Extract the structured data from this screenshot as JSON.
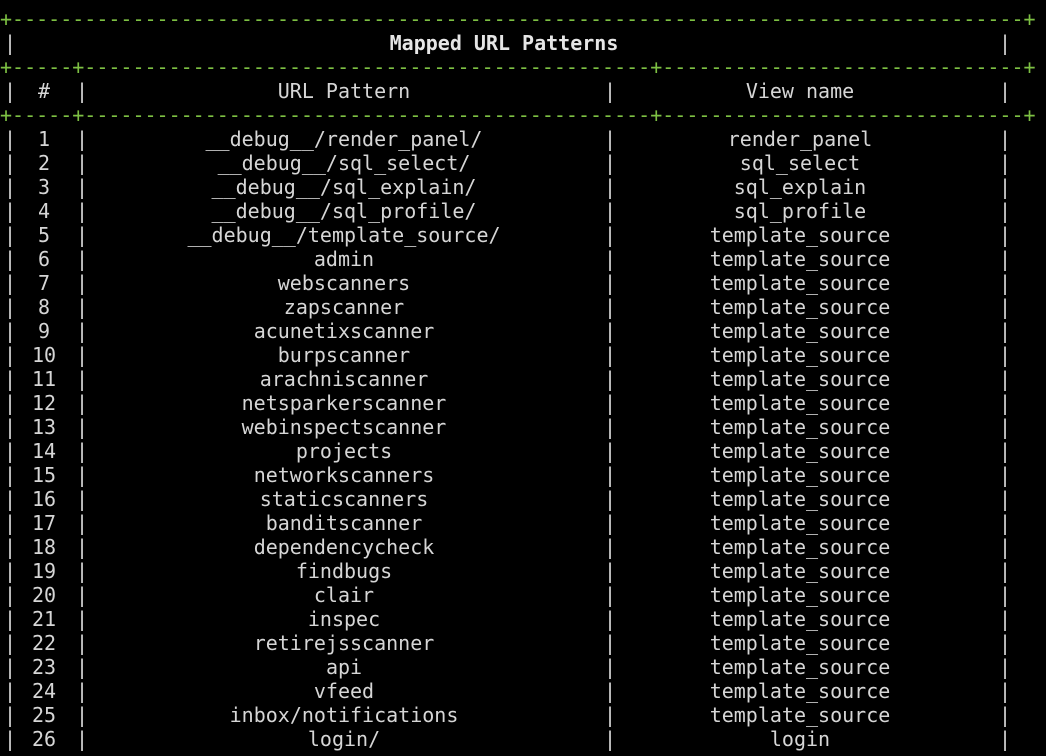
{
  "title": "Mapped URL Patterns",
  "headers": {
    "index": "#",
    "url_pattern": "URL Pattern",
    "view_name": "View name"
  },
  "rows": [
    {
      "num": "1",
      "pattern": "__debug__/render_panel/",
      "view": "render_panel"
    },
    {
      "num": "2",
      "pattern": "__debug__/sql_select/",
      "view": "sql_select"
    },
    {
      "num": "3",
      "pattern": "__debug__/sql_explain/",
      "view": "sql_explain"
    },
    {
      "num": "4",
      "pattern": "__debug__/sql_profile/",
      "view": "sql_profile"
    },
    {
      "num": "5",
      "pattern": "__debug__/template_source/",
      "view": "template_source"
    },
    {
      "num": "6",
      "pattern": "admin",
      "view": "template_source"
    },
    {
      "num": "7",
      "pattern": "webscanners",
      "view": "template_source"
    },
    {
      "num": "8",
      "pattern": "zapscanner",
      "view": "template_source"
    },
    {
      "num": "9",
      "pattern": "acunetixscanner",
      "view": "template_source"
    },
    {
      "num": "10",
      "pattern": "burpscanner",
      "view": "template_source"
    },
    {
      "num": "11",
      "pattern": "arachniscanner",
      "view": "template_source"
    },
    {
      "num": "12",
      "pattern": "netsparkerscanner",
      "view": "template_source"
    },
    {
      "num": "13",
      "pattern": "webinspectscanner",
      "view": "template_source"
    },
    {
      "num": "14",
      "pattern": "projects",
      "view": "template_source"
    },
    {
      "num": "15",
      "pattern": "networkscanners",
      "view": "template_source"
    },
    {
      "num": "16",
      "pattern": "staticscanners",
      "view": "template_source"
    },
    {
      "num": "17",
      "pattern": "banditscanner",
      "view": "template_source"
    },
    {
      "num": "18",
      "pattern": "dependencycheck",
      "view": "template_source"
    },
    {
      "num": "19",
      "pattern": "findbugs",
      "view": "template_source"
    },
    {
      "num": "20",
      "pattern": "clair",
      "view": "template_source"
    },
    {
      "num": "21",
      "pattern": "inspec",
      "view": "template_source"
    },
    {
      "num": "22",
      "pattern": "retirejsscanner",
      "view": "template_source"
    },
    {
      "num": "23",
      "pattern": "api",
      "view": "template_source"
    },
    {
      "num": "24",
      "pattern": "vfeed",
      "view": "template_source"
    },
    {
      "num": "25",
      "pattern": "inbox/notifications",
      "view": "template_source"
    },
    {
      "num": "26",
      "pattern": "login/",
      "view": "login"
    }
  ],
  "colors": {
    "background": "#000000",
    "text": "#d6d6d6",
    "border": "#7dc043"
  }
}
